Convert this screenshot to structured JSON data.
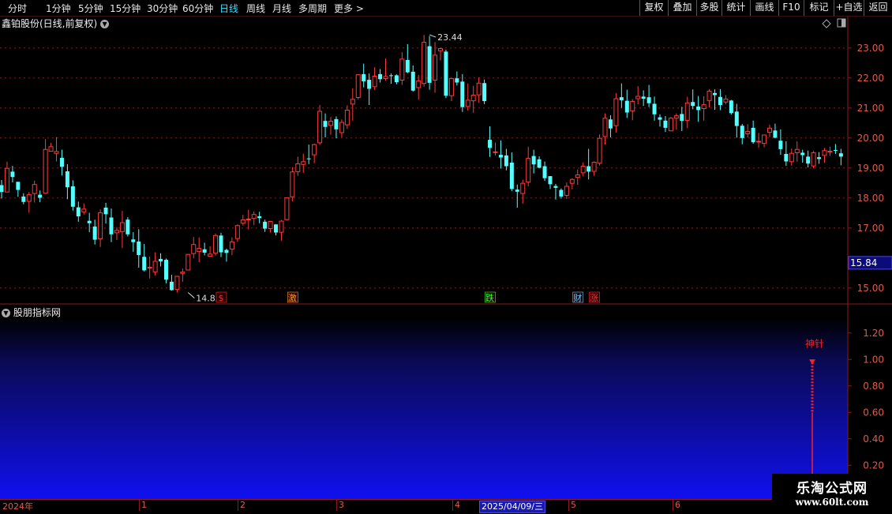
{
  "toolbar": {
    "periods": [
      "分时",
      "1分钟",
      "5分钟",
      "15分钟",
      "30分钟",
      "60分钟",
      "日线",
      "周线",
      "月线",
      "多周期",
      "更多"
    ],
    "active_period": "日线",
    "more_arrow": ">",
    "buttons": [
      "复权",
      "叠加",
      "多股",
      "统计",
      "画线",
      "F10",
      "标记",
      "+自选",
      "返回"
    ]
  },
  "main_chart": {
    "title": "鑫铂股份(日线,前复权)",
    "panel_icons": [
      "diamond-icon",
      "square-icon"
    ]
  },
  "indicator": {
    "title": "股朋指标网",
    "signal_label": "神针",
    "signal_value": 1.0,
    "signal_solid_from": 0.6
  },
  "time_axis": {
    "labels": [
      "2024年",
      "1",
      "2",
      "3",
      "4",
      "2025/04/09/三",
      "5",
      "6"
    ]
  },
  "watermark": {
    "main": "乐淘公式网",
    "sub": "www.60lt.com"
  },
  "colors": {
    "up": "#ff3b3b",
    "down": "#54ffff",
    "grid": "#8b1a1a",
    "bg": "#000000",
    "signal": "#ff2020"
  },
  "chart_data": [
    {
      "type": "candlestick",
      "ylim": [
        14.6,
        23.6
      ],
      "yticks": [
        "23.00",
        "22.00",
        "21.00",
        "20.00",
        "19.00",
        "18.00",
        "17.00",
        "15.00"
      ],
      "ytick_values": [
        23,
        22,
        21,
        20,
        19,
        18,
        17,
        15
      ],
      "current_price": "15.84",
      "current_price_value": 15.84,
      "annotations": [
        {
          "text": "23.44",
          "index": 78,
          "value": 23.44
        },
        {
          "text": "14.85",
          "index": 34,
          "value": 14.85
        }
      ],
      "event_markers": [
        {
          "text": "$",
          "index": 40,
          "color": "#ff3030"
        },
        {
          "text": "激",
          "index": 53,
          "color": "#ff9933"
        },
        {
          "text": "跌",
          "index": 89,
          "color": "#33ff33"
        },
        {
          "text": "财",
          "index": 105,
          "color": "#66ccff"
        },
        {
          "text": "涨",
          "index": 108,
          "color": "#ff3333"
        }
      ],
      "ohlc": [
        [
          18.43,
          18.6,
          17.98,
          18.2
        ],
        [
          18.2,
          19.21,
          18.2,
          18.99
        ],
        [
          18.88,
          19.07,
          18.52,
          18.7
        ],
        [
          18.54,
          18.54,
          18.04,
          18.27
        ],
        [
          18.05,
          18.16,
          17.79,
          17.87
        ],
        [
          17.89,
          18.2,
          17.51,
          18.11
        ],
        [
          18.15,
          18.58,
          17.85,
          18.45
        ],
        [
          18.11,
          18.25,
          17.86,
          18.01
        ],
        [
          18.16,
          19.96,
          18.14,
          19.62
        ],
        [
          19.56,
          19.84,
          19.58,
          19.71
        ],
        [
          19.49,
          20.03,
          19.22,
          19.55
        ],
        [
          19.34,
          19.61,
          18.75,
          19.04
        ],
        [
          18.89,
          19.13,
          17.96,
          18.36
        ],
        [
          18.39,
          18.59,
          17.58,
          17.71
        ],
        [
          17.69,
          17.88,
          17.21,
          17.39
        ],
        [
          17.54,
          17.82,
          17.45,
          17.63
        ],
        [
          17.24,
          17.51,
          16.86,
          17.16
        ],
        [
          17.05,
          17.28,
          16.45,
          16.61
        ],
        [
          16.64,
          17.62,
          16.37,
          17.51
        ],
        [
          17.68,
          17.84,
          17.15,
          17.46
        ],
        [
          17.35,
          17.65,
          16.53,
          16.79
        ],
        [
          16.84,
          17.03,
          16.6,
          16.92
        ],
        [
          16.88,
          17.57,
          16.33,
          17.18
        ],
        [
          17.28,
          17.36,
          16.72,
          16.79
        ],
        [
          16.62,
          16.86,
          16.21,
          16.53
        ],
        [
          16.55,
          16.96,
          15.68,
          16.1
        ],
        [
          16.04,
          16.47,
          15.55,
          15.59
        ],
        [
          15.69,
          16.05,
          15.32,
          15.69
        ],
        [
          15.54,
          16.19,
          15.42,
          15.89
        ],
        [
          15.97,
          16.16,
          15.72,
          15.89
        ],
        [
          15.94,
          15.98,
          15.16,
          15.28
        ],
        [
          15.21,
          15.44,
          14.91,
          14.93
        ],
        [
          14.95,
          15.41,
          14.85,
          15.39
        ],
        [
          15.49,
          15.65,
          15.21,
          15.53
        ],
        [
          15.6,
          16.14,
          15.59,
          16.12
        ],
        [
          16.15,
          16.7,
          15.99,
          16.45
        ],
        [
          16.22,
          16.69,
          15.86,
          16.32
        ],
        [
          16.29,
          16.51,
          16.09,
          16.18
        ],
        [
          16.06,
          16.39,
          16.05,
          16.13
        ],
        [
          16.16,
          16.82,
          16.08,
          16.75
        ],
        [
          16.75,
          16.84,
          16.03,
          16.19
        ],
        [
          16.27,
          16.31,
          15.88,
          16.17
        ],
        [
          16.3,
          16.69,
          16.1,
          16.54
        ],
        [
          16.65,
          17.12,
          16.54,
          17.08
        ],
        [
          17.16,
          17.44,
          17.08,
          17.27
        ],
        [
          17.28,
          17.61,
          16.95,
          17.3
        ],
        [
          17.32,
          17.56,
          17.1,
          17.45
        ],
        [
          17.39,
          17.54,
          17.16,
          17.33
        ],
        [
          17.21,
          17.28,
          16.87,
          16.98
        ],
        [
          16.98,
          17.24,
          16.85,
          17.22
        ],
        [
          17.12,
          17.13,
          16.75,
          16.85
        ],
        [
          16.86,
          17.27,
          16.58,
          17.23
        ],
        [
          17.28,
          18.01,
          17.25,
          18.01
        ],
        [
          18.04,
          19.03,
          17.89,
          18.87
        ],
        [
          18.88,
          19.38,
          18.74,
          19.14
        ],
        [
          19.12,
          19.48,
          18.84,
          19.21
        ],
        [
          19.32,
          19.78,
          19.13,
          19.31
        ],
        [
          19.44,
          19.81,
          19.16,
          19.78
        ],
        [
          19.84,
          21.1,
          19.77,
          20.89
        ],
        [
          20.57,
          20.82,
          20.02,
          20.37
        ],
        [
          20.42,
          20.7,
          20.11,
          20.56
        ],
        [
          20.63,
          20.72,
          19.99,
          20.29
        ],
        [
          20.18,
          20.62,
          20.02,
          20.52
        ],
        [
          20.44,
          21.09,
          20.3,
          20.93
        ],
        [
          21.13,
          21.66,
          20.58,
          21.29
        ],
        [
          21.35,
          22.12,
          21.28,
          22.11
        ],
        [
          22.13,
          22.48,
          21.69,
          21.89
        ],
        [
          21.94,
          22.15,
          21.1,
          21.64
        ],
        [
          21.71,
          22.36,
          21.6,
          22.06
        ],
        [
          22.13,
          22.3,
          21.85,
          21.96
        ],
        [
          21.98,
          22.65,
          21.91,
          22.05
        ],
        [
          22.09,
          22.15,
          21.81,
          22.08
        ],
        [
          22.09,
          22.12,
          21.79,
          21.86
        ],
        [
          21.93,
          22.86,
          21.77,
          22.63
        ],
        [
          22.6,
          23.13,
          22.16,
          22.19
        ],
        [
          22.21,
          22.42,
          21.55,
          21.58
        ],
        [
          21.68,
          22.1,
          21.28,
          21.9
        ],
        [
          21.82,
          23.44,
          21.71,
          23.19
        ],
        [
          23.06,
          23.4,
          21.61,
          21.84
        ],
        [
          21.93,
          23.2,
          21.51,
          22.76
        ],
        [
          22.91,
          23.01,
          22.59,
          22.98
        ],
        [
          22.88,
          22.95,
          21.33,
          21.41
        ],
        [
          21.41,
          22.01,
          21.23,
          21.98
        ],
        [
          21.99,
          22.22,
          21.75,
          21.85
        ],
        [
          21.88,
          22.13,
          20.87,
          21.03
        ],
        [
          21.05,
          21.82,
          20.91,
          21.26
        ],
        [
          21.24,
          21.74,
          20.84,
          21.43
        ],
        [
          21.44,
          22.02,
          21.17,
          21.83
        ],
        [
          21.83,
          21.95,
          21.13,
          21.23
        ],
        [
          19.94,
          20.39,
          19.37,
          19.67
        ],
        [
          19.53,
          19.85,
          19.42,
          19.54
        ],
        [
          19.44,
          19.92,
          18.98,
          19.35
        ],
        [
          19.42,
          19.64,
          18.92,
          19.06
        ],
        [
          19.18,
          19.52,
          18.23,
          18.3
        ],
        [
          18.28,
          18.45,
          17.68,
          18.21
        ],
        [
          18.15,
          18.61,
          17.81,
          18.49
        ],
        [
          18.53,
          19.71,
          18.39,
          19.32
        ],
        [
          19.4,
          19.61,
          18.82,
          19.12
        ],
        [
          19.29,
          19.39,
          18.99,
          19.01
        ],
        [
          19.06,
          19.22,
          18.57,
          18.66
        ],
        [
          18.73,
          18.73,
          18.3,
          18.46
        ],
        [
          18.4,
          18.47,
          17.95,
          18.34
        ],
        [
          18.27,
          18.32,
          17.98,
          18.05
        ],
        [
          18.09,
          18.52,
          17.97,
          18.39
        ],
        [
          18.49,
          18.66,
          18.29,
          18.62
        ],
        [
          18.69,
          18.95,
          18.44,
          18.77
        ],
        [
          18.84,
          19.19,
          18.72,
          19.06
        ],
        [
          19.06,
          19.64,
          18.62,
          18.88
        ],
        [
          18.89,
          19.22,
          18.74,
          19.19
        ],
        [
          19.16,
          20.12,
          19.08,
          19.99
        ],
        [
          20.05,
          20.82,
          19.78,
          20.66
        ],
        [
          20.62,
          20.76,
          20.02,
          20.32
        ],
        [
          20.41,
          21.5,
          20.18,
          21.31
        ],
        [
          21.36,
          21.82,
          21.01,
          21.26
        ],
        [
          21.24,
          21.61,
          20.67,
          20.85
        ],
        [
          20.9,
          21.3,
          20.59,
          21.22
        ],
        [
          21.31,
          21.73,
          21.12,
          21.39
        ],
        [
          21.38,
          21.59,
          21.07,
          21.31
        ],
        [
          21.36,
          21.77,
          21.03,
          21.16
        ],
        [
          21.14,
          21.38,
          20.58,
          20.79
        ],
        [
          20.69,
          20.79,
          20.38,
          20.61
        ],
        [
          20.58,
          20.73,
          20.2,
          20.34
        ],
        [
          20.24,
          20.7,
          20.23,
          20.66
        ],
        [
          20.66,
          20.82,
          20.28,
          20.74
        ],
        [
          20.8,
          21.04,
          20.23,
          20.57
        ],
        [
          20.59,
          21.37,
          20.33,
          21.17
        ],
        [
          21.2,
          21.62,
          20.96,
          21.07
        ],
        [
          21.05,
          21.4,
          20.54,
          20.93
        ],
        [
          20.98,
          21.39,
          20.58,
          21.11
        ],
        [
          21.25,
          21.63,
          21.02,
          21.56
        ],
        [
          21.5,
          21.62,
          20.94,
          21.43
        ],
        [
          21.37,
          21.63,
          20.93,
          21.1
        ],
        [
          21.2,
          21.43,
          21.12,
          21.3
        ],
        [
          21.25,
          21.27,
          20.78,
          20.83
        ],
        [
          20.88,
          21.14,
          20.01,
          20.4
        ],
        [
          20.41,
          20.47,
          19.79,
          20.0
        ],
        [
          20.14,
          20.46,
          20.02,
          20.22
        ],
        [
          20.34,
          20.58,
          19.81,
          19.86
        ],
        [
          19.88,
          20.17,
          19.68,
          19.89
        ],
        [
          19.82,
          20.1,
          19.69,
          20.1
        ],
        [
          20.19,
          20.44,
          20.03,
          20.33
        ],
        [
          20.25,
          20.48,
          19.99,
          20.01
        ],
        [
          19.91,
          20.29,
          19.44,
          19.63
        ],
        [
          19.47,
          19.89,
          19.07,
          19.22
        ],
        [
          19.21,
          19.65,
          19.08,
          19.49
        ],
        [
          19.51,
          19.89,
          19.21,
          19.62
        ],
        [
          19.51,
          19.61,
          19.18,
          19.43
        ],
        [
          19.38,
          19.58,
          19.02,
          19.15
        ],
        [
          19.07,
          19.57,
          18.99,
          19.51
        ],
        [
          19.36,
          19.53,
          19.14,
          19.3
        ],
        [
          19.42,
          19.67,
          19.18,
          19.58
        ],
        [
          19.53,
          19.71,
          19.41,
          19.56
        ],
        [
          19.6,
          19.8,
          19.47,
          19.58
        ],
        [
          19.49,
          19.64,
          19.09,
          19.38
        ]
      ]
    },
    {
      "type": "bar",
      "ylim": [
        0.1,
        1.3
      ],
      "yticks": [
        "1.20",
        "1.00",
        "0.80",
        "0.60",
        "0.40",
        "0.20"
      ],
      "ytick_values": [
        1.2,
        1.0,
        0.8,
        0.6,
        0.4,
        0.2
      ],
      "series": [
        {
          "values": [
            1.0
          ]
        }
      ]
    }
  ]
}
